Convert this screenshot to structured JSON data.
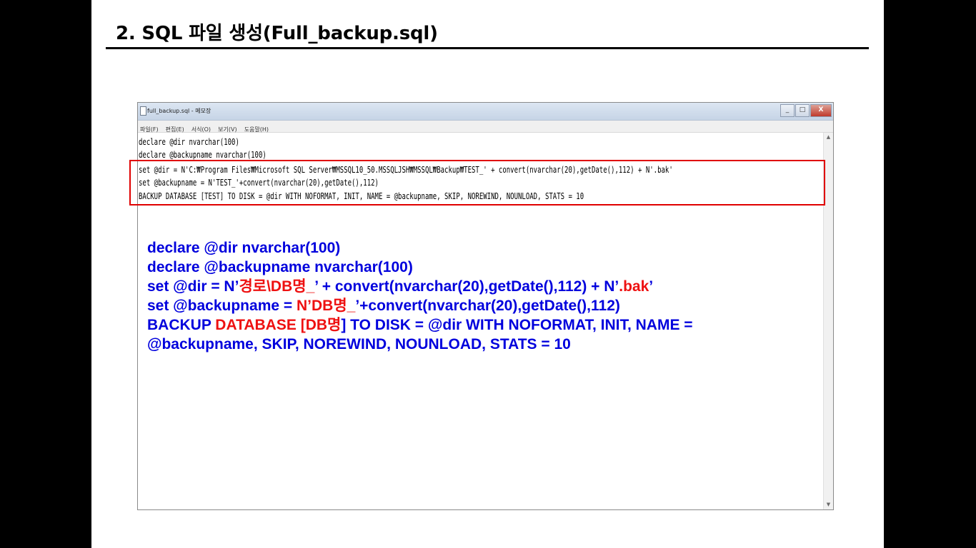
{
  "slide": {
    "title": "2. SQL 파일 생성(Full_backup.sql)"
  },
  "notepad": {
    "window_title": "full_backup.sql - 메모장",
    "window_buttons": [
      "_",
      "□",
      "X"
    ],
    "menu": [
      "파일(F)",
      "편집(E)",
      "서식(O)",
      "보기(V)",
      "도움말(H)"
    ],
    "lines": [
      "declare @dir nvarchar(100)",
      "declare @backupname nvarchar(100)",
      "set @dir = N'C:₩Program Files₩Microsoft SQL Server₩MSSQL10_50.MSSQLJSH₩MSSQL₩Backup₩TEST_' + convert(nvarchar(20),getDate(),112) + N'.bak'",
      "set @backupname = N'TEST_'+convert(nvarchar(20),getDate(),112)",
      "BACKUP DATABASE [TEST] TO DISK = @dir WITH NOFORMAT, INIT, NAME = @backupname, SKIP, NOREWIND, NOUNLOAD, STATS = 10"
    ],
    "scroll_up": "▲",
    "scroll_down": "▼"
  },
  "highlight_color": "#e00000",
  "example": {
    "blue": "#0000dd",
    "red": "#ee1111",
    "line1": "declare @dir nvarchar(100)",
    "line2": "declare @backupname nvarchar(100)",
    "line3": {
      "a": "set @dir = N’",
      "b": "경로\\DB명_",
      "c": "’ + convert(nvarchar(20),getDate(),112) + N’",
      "d": ".bak",
      "e": "’"
    },
    "line4": {
      "a": "set @backupname = ",
      "b": "N’DB명_",
      "c": "’+convert(nvarchar(20),getDate(),112)"
    },
    "line5": {
      "a": "BACKUP ",
      "b": "DATABASE",
      "c": " [",
      "d": "DB명",
      "e": "] TO DISK = @dir WITH NOFORMAT, INIT, NAME ="
    },
    "line6": "@backupname, SKIP, NOREWIND, NOUNLOAD, STATS = 10"
  }
}
